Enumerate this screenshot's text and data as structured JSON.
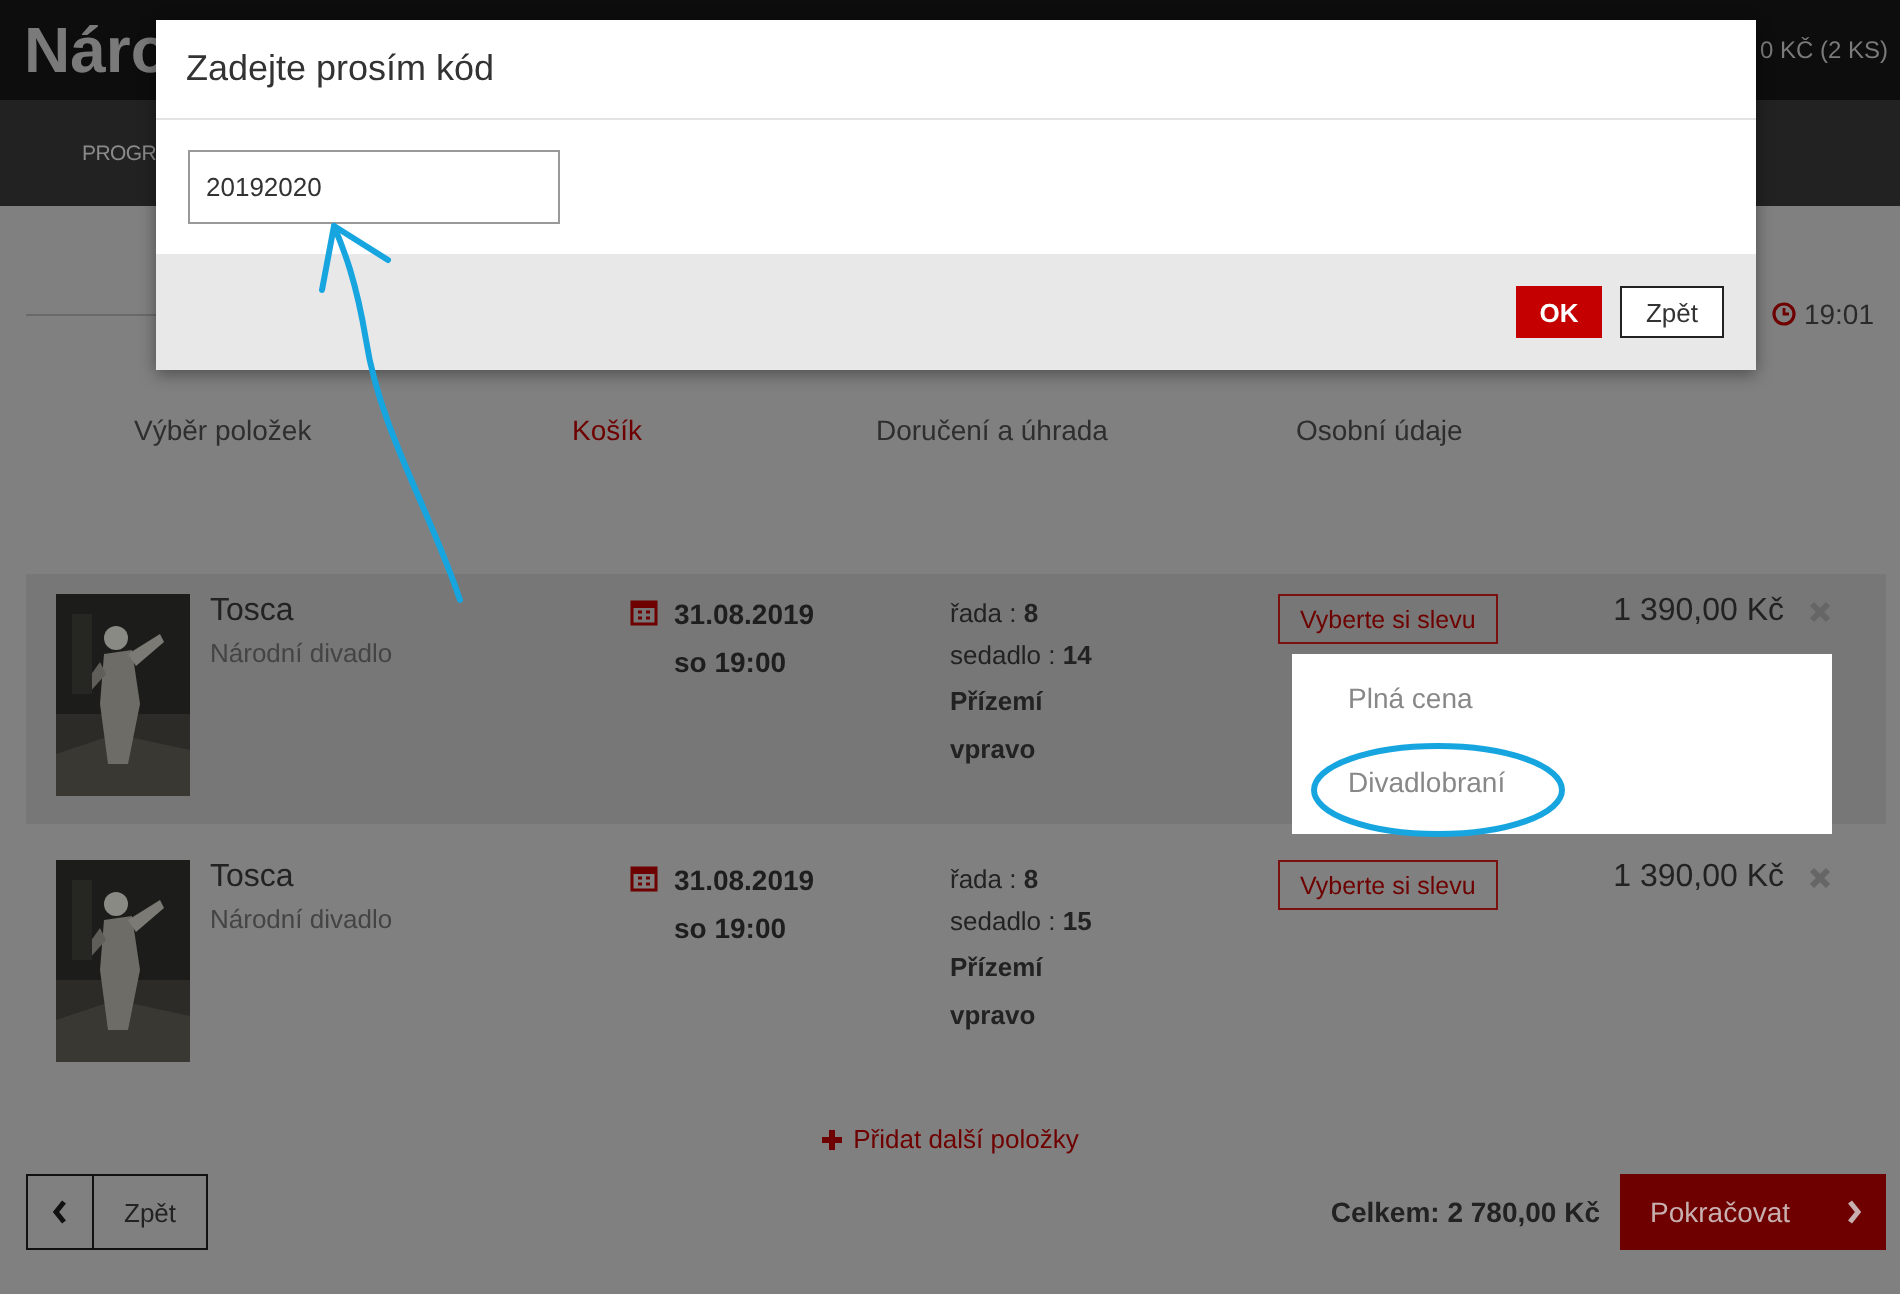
{
  "header": {
    "logo": "Náro",
    "cart": "0 KČ (2 KS)"
  },
  "nav": {
    "items": [
      "PROGR"
    ]
  },
  "timer": "19:01",
  "steps": [
    {
      "label": "Výběr položek",
      "selected": false
    },
    {
      "label": "Košík",
      "selected": true
    },
    {
      "label": "Doručení a úhrada",
      "selected": false
    },
    {
      "label": "Osobní údaje",
      "selected": false
    }
  ],
  "items": [
    {
      "title": "Tosca",
      "venue": "Národní divadlo",
      "date": "31.08.2019",
      "time": "so 19:00",
      "row_label": "řada :",
      "row": "8",
      "seat_label": "sedadlo :",
      "seat": "14",
      "section": "Přízemí vpravo",
      "discount_button": "Vyberte si slevu",
      "price": "1 390,00 Kč",
      "highlighted": true,
      "discount_menu": {
        "options": [
          "Plná cena",
          "Divadlobraní"
        ]
      }
    },
    {
      "title": "Tosca",
      "venue": "Národní divadlo",
      "date": "31.08.2019",
      "time": "so 19:00",
      "row_label": "řada :",
      "row": "8",
      "seat_label": "sedadlo :",
      "seat": "15",
      "section": "Přízemí vpravo",
      "discount_button": "Vyberte si slevu",
      "price": "1 390,00 Kč",
      "highlighted": false
    }
  ],
  "add_more": "Přidat další položky",
  "footer": {
    "back": "Zpět",
    "total": "Celkem: 2 780,00 Kč",
    "continue": "Pokračovat"
  },
  "dialog": {
    "title": "Zadejte prosím kód",
    "input_value": "20192020",
    "ok": "OK",
    "cancel": "Zpět"
  }
}
